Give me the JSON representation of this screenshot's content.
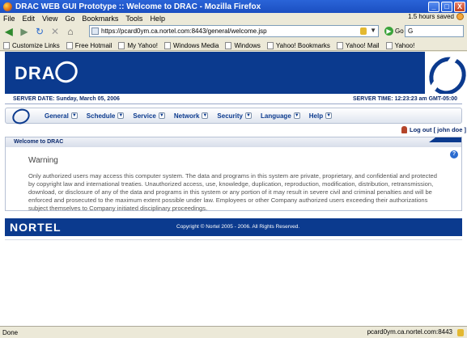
{
  "window": {
    "title": "DRAC WEB GUI Prototype :: Welcome to DRAC - Mozilla Firefox",
    "minimize": "_",
    "maximize": "□",
    "close": "X"
  },
  "menu": [
    "File",
    "Edit",
    "View",
    "Go",
    "Bookmarks",
    "Tools",
    "Help"
  ],
  "saved_status": "1.5 hours saved",
  "address": {
    "url": "https://pcard0ym.ca.nortel.com:8443/general/welcome.jsp",
    "go_label": "Go"
  },
  "search": {
    "value": "G"
  },
  "bookmarks": [
    "Customize Links",
    "Free Hotmail",
    "My Yahoo!",
    "Windows Media",
    "Windows",
    "Yahoo! Bookmarks",
    "Yahoo! Mail",
    "Yahoo!"
  ],
  "page": {
    "logo_text": "DRA",
    "server_date": "SERVER DATE: Sunday, March 05, 2006",
    "server_time": "SERVER TIME: 12:23:23 am GMT-05:00",
    "nav": [
      "General",
      "Schedule",
      "Service",
      "Network",
      "Security",
      "Language",
      "Help"
    ],
    "logout": "Log out [ john doe ]",
    "panel_title": "Welcome to DRAC",
    "warning_title": "Warning",
    "warning_body": "Only authorized users may access this computer system. The data and programs in this system are private, proprietary, and confidential and protected by copyright law and international treaties. Unauthorized access, use, knowledge, duplication, reproduction, modification, distribution, retransmission, download, or disclosure of any of the data and programs in this system or any portion of it may result in severe civil and criminal penalties and will be enforced and prosecuted to the maximum extent possible under law. Employees or other Company authorized users exceeding their authorizations subject themselves to Company initiated disciplinary proceedings.",
    "footer_brand": "NORTEL",
    "copyright": "Copyright © Nortel 2005 - 2006. All Rights Reserved."
  },
  "status": {
    "left": "Done",
    "host": "pcard0ym.ca.nortel.com:8443"
  }
}
